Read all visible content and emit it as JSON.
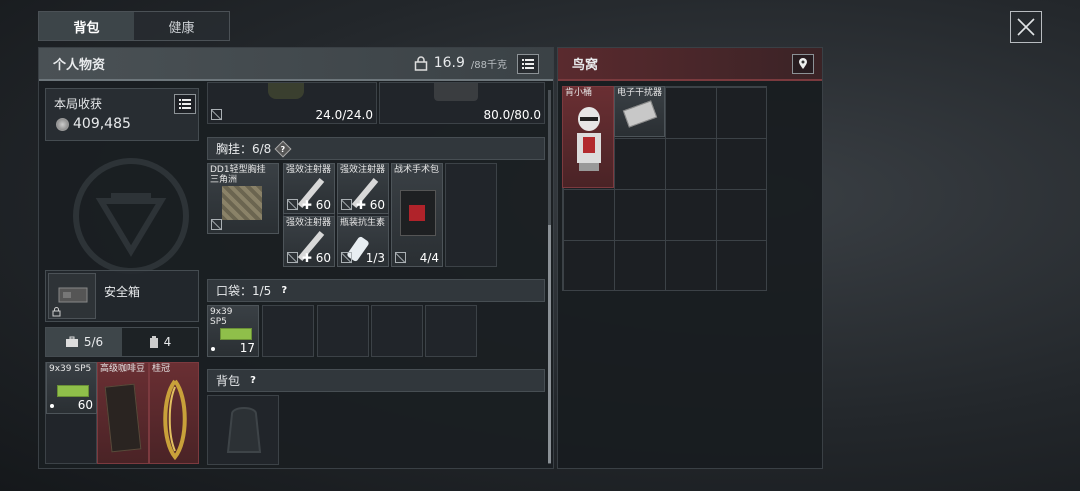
{
  "tabs": [
    {
      "label": "背包"
    },
    {
      "label": "健康"
    }
  ],
  "left_panel": {
    "title": "个人物资",
    "weight_value": "16.9",
    "weight_capacity": "/88千克",
    "earnings": {
      "label": "本局收获",
      "value": "409,485"
    },
    "top_items": [
      {
        "count": "24.0/24.0"
      },
      {
        "count": "80.0/80.0"
      }
    ],
    "vest": {
      "title": "胸挂：6/8",
      "help": "?",
      "rig": {
        "name": "DD1轻型胸挂三角洲"
      },
      "items": [
        {
          "name": "强效注射器",
          "count": "60"
        },
        {
          "name": "强效注射器",
          "count": "60"
        },
        {
          "name": "战术手术包",
          "count": "4/4"
        },
        {
          "name": "强效注射器",
          "count": "60"
        },
        {
          "name": "瓶装抗生素",
          "count": "1/3"
        }
      ]
    },
    "pocket": {
      "title": "口袋：1/5",
      "help": "?",
      "item": {
        "name": "9x39 SP5",
        "count": "17"
      }
    },
    "backpack": {
      "title": "背包",
      "help": "?"
    },
    "safebox": {
      "label": "安全箱"
    },
    "safe_tabs": [
      {
        "label": "5/6"
      },
      {
        "label": "4"
      }
    ],
    "safe_items": [
      {
        "name": "9x39 SP5",
        "count": "60"
      },
      {
        "name": "高级咖啡豆"
      },
      {
        "name": "桂冠"
      }
    ]
  },
  "right_panel": {
    "title": "鸟窝",
    "items": [
      {
        "name": "肯小桶"
      },
      {
        "name": "电子干扰器"
      }
    ]
  },
  "colors": {
    "accent_red": "#7a3a3e",
    "header_gray": "#4a5155"
  }
}
